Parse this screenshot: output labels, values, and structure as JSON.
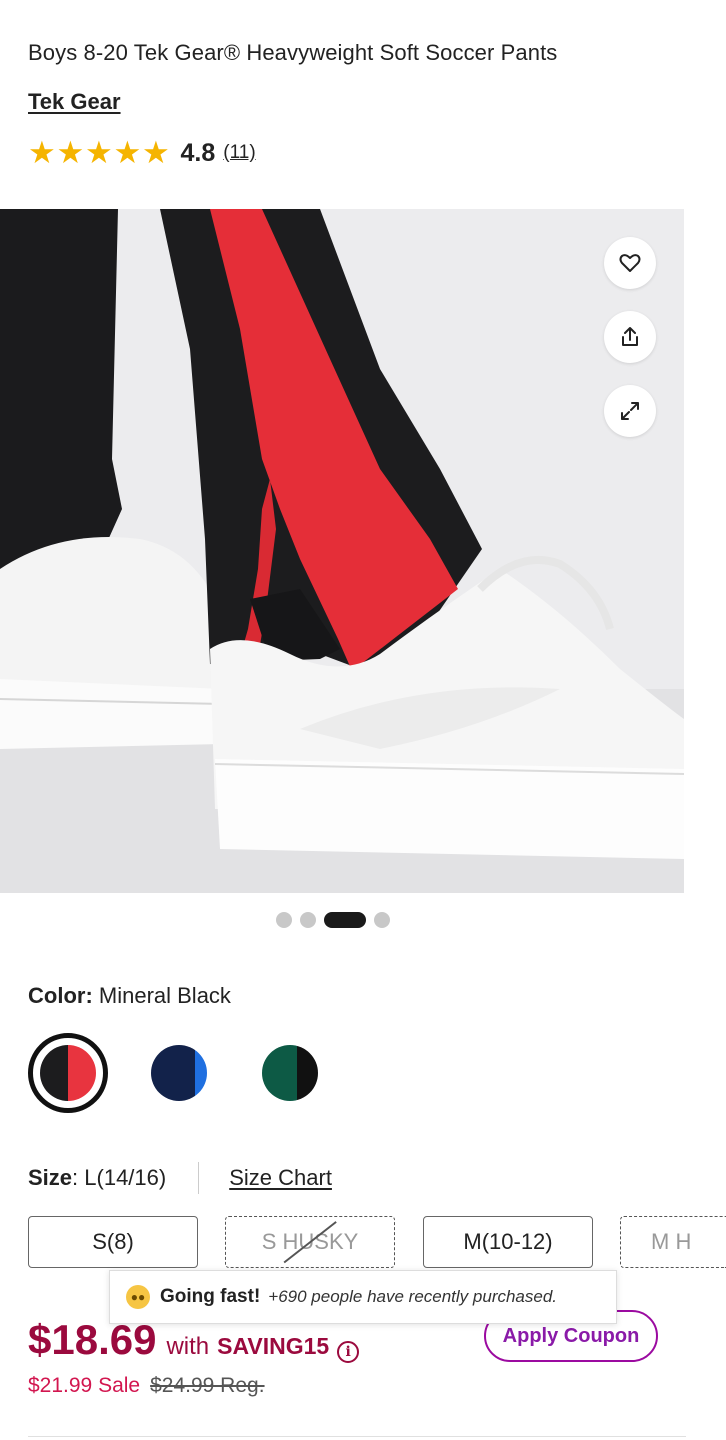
{
  "product": {
    "title": "Boys 8-20 Tek Gear® Heavyweight Soft Soccer Pants",
    "brand": "Tek Gear",
    "rating": "4.8",
    "review_count": "(11)",
    "stars": 5
  },
  "gallery": {
    "image_description_icon": "product-photo",
    "actions": [
      "heart-icon",
      "share-icon",
      "expand-icon"
    ],
    "slide_count": 4,
    "active_slide": 3
  },
  "color": {
    "label": "Color:",
    "selected": "Mineral Black",
    "swatches": [
      {
        "name": "Mineral Black",
        "colors": [
          "#1c1c1e",
          "#e8343f"
        ]
      },
      {
        "name": "Navy",
        "colors": [
          "#12224a",
          "#1f6fe0"
        ]
      },
      {
        "name": "Green",
        "colors": [
          "#0d5a45",
          "#111111"
        ]
      }
    ]
  },
  "size": {
    "label": "Size",
    "selected": "L(14/16)",
    "chart_link": "Size Chart",
    "options": [
      {
        "label": "S(8)",
        "available": true
      },
      {
        "label": "S HUSKY",
        "available": false
      },
      {
        "label": "M(10-12)",
        "available": true
      },
      {
        "label": "M H",
        "available": false
      }
    ]
  },
  "toast": {
    "title": "Going fast!",
    "message": "+690 people have recently purchased."
  },
  "price": {
    "coupon_price": "$18.69",
    "with": "with",
    "code": "SAVING15",
    "sale_price": "$21.99 Sale",
    "regular_price": "$24.99 Reg.",
    "apply_coupon": "Apply Coupon"
  },
  "colors": {
    "accent_price": "#9b0a3e",
    "sale": "#d2164f",
    "coupon": "#8a1aa8",
    "stars": "#f5b400"
  }
}
